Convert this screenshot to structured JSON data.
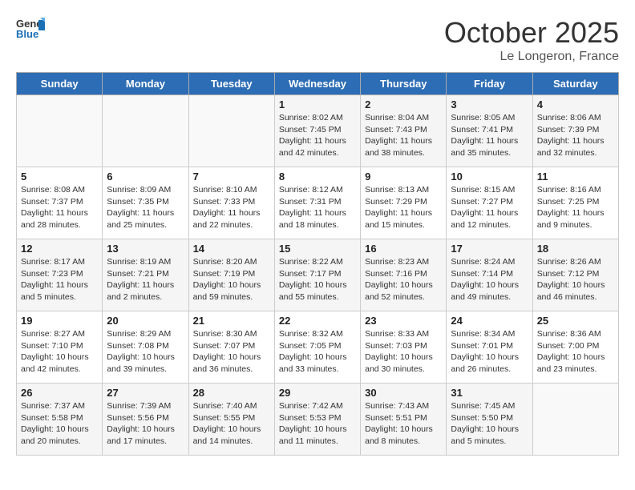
{
  "logo": {
    "line1": "General",
    "line2": "Blue"
  },
  "title": "October 2025",
  "location": "Le Longeron, France",
  "days_header": [
    "Sunday",
    "Monday",
    "Tuesday",
    "Wednesday",
    "Thursday",
    "Friday",
    "Saturday"
  ],
  "weeks": [
    [
      {
        "num": "",
        "info": ""
      },
      {
        "num": "",
        "info": ""
      },
      {
        "num": "",
        "info": ""
      },
      {
        "num": "1",
        "info": "Sunrise: 8:02 AM\nSunset: 7:45 PM\nDaylight: 11 hours and 42 minutes."
      },
      {
        "num": "2",
        "info": "Sunrise: 8:04 AM\nSunset: 7:43 PM\nDaylight: 11 hours and 38 minutes."
      },
      {
        "num": "3",
        "info": "Sunrise: 8:05 AM\nSunset: 7:41 PM\nDaylight: 11 hours and 35 minutes."
      },
      {
        "num": "4",
        "info": "Sunrise: 8:06 AM\nSunset: 7:39 PM\nDaylight: 11 hours and 32 minutes."
      }
    ],
    [
      {
        "num": "5",
        "info": "Sunrise: 8:08 AM\nSunset: 7:37 PM\nDaylight: 11 hours and 28 minutes."
      },
      {
        "num": "6",
        "info": "Sunrise: 8:09 AM\nSunset: 7:35 PM\nDaylight: 11 hours and 25 minutes."
      },
      {
        "num": "7",
        "info": "Sunrise: 8:10 AM\nSunset: 7:33 PM\nDaylight: 11 hours and 22 minutes."
      },
      {
        "num": "8",
        "info": "Sunrise: 8:12 AM\nSunset: 7:31 PM\nDaylight: 11 hours and 18 minutes."
      },
      {
        "num": "9",
        "info": "Sunrise: 8:13 AM\nSunset: 7:29 PM\nDaylight: 11 hours and 15 minutes."
      },
      {
        "num": "10",
        "info": "Sunrise: 8:15 AM\nSunset: 7:27 PM\nDaylight: 11 hours and 12 minutes."
      },
      {
        "num": "11",
        "info": "Sunrise: 8:16 AM\nSunset: 7:25 PM\nDaylight: 11 hours and 9 minutes."
      }
    ],
    [
      {
        "num": "12",
        "info": "Sunrise: 8:17 AM\nSunset: 7:23 PM\nDaylight: 11 hours and 5 minutes."
      },
      {
        "num": "13",
        "info": "Sunrise: 8:19 AM\nSunset: 7:21 PM\nDaylight: 11 hours and 2 minutes."
      },
      {
        "num": "14",
        "info": "Sunrise: 8:20 AM\nSunset: 7:19 PM\nDaylight: 10 hours and 59 minutes."
      },
      {
        "num": "15",
        "info": "Sunrise: 8:22 AM\nSunset: 7:17 PM\nDaylight: 10 hours and 55 minutes."
      },
      {
        "num": "16",
        "info": "Sunrise: 8:23 AM\nSunset: 7:16 PM\nDaylight: 10 hours and 52 minutes."
      },
      {
        "num": "17",
        "info": "Sunrise: 8:24 AM\nSunset: 7:14 PM\nDaylight: 10 hours and 49 minutes."
      },
      {
        "num": "18",
        "info": "Sunrise: 8:26 AM\nSunset: 7:12 PM\nDaylight: 10 hours and 46 minutes."
      }
    ],
    [
      {
        "num": "19",
        "info": "Sunrise: 8:27 AM\nSunset: 7:10 PM\nDaylight: 10 hours and 42 minutes."
      },
      {
        "num": "20",
        "info": "Sunrise: 8:29 AM\nSunset: 7:08 PM\nDaylight: 10 hours and 39 minutes."
      },
      {
        "num": "21",
        "info": "Sunrise: 8:30 AM\nSunset: 7:07 PM\nDaylight: 10 hours and 36 minutes."
      },
      {
        "num": "22",
        "info": "Sunrise: 8:32 AM\nSunset: 7:05 PM\nDaylight: 10 hours and 33 minutes."
      },
      {
        "num": "23",
        "info": "Sunrise: 8:33 AM\nSunset: 7:03 PM\nDaylight: 10 hours and 30 minutes."
      },
      {
        "num": "24",
        "info": "Sunrise: 8:34 AM\nSunset: 7:01 PM\nDaylight: 10 hours and 26 minutes."
      },
      {
        "num": "25",
        "info": "Sunrise: 8:36 AM\nSunset: 7:00 PM\nDaylight: 10 hours and 23 minutes."
      }
    ],
    [
      {
        "num": "26",
        "info": "Sunrise: 7:37 AM\nSunset: 5:58 PM\nDaylight: 10 hours and 20 minutes."
      },
      {
        "num": "27",
        "info": "Sunrise: 7:39 AM\nSunset: 5:56 PM\nDaylight: 10 hours and 17 minutes."
      },
      {
        "num": "28",
        "info": "Sunrise: 7:40 AM\nSunset: 5:55 PM\nDaylight: 10 hours and 14 minutes."
      },
      {
        "num": "29",
        "info": "Sunrise: 7:42 AM\nSunset: 5:53 PM\nDaylight: 10 hours and 11 minutes."
      },
      {
        "num": "30",
        "info": "Sunrise: 7:43 AM\nSunset: 5:51 PM\nDaylight: 10 hours and 8 minutes."
      },
      {
        "num": "31",
        "info": "Sunrise: 7:45 AM\nSunset: 5:50 PM\nDaylight: 10 hours and 5 minutes."
      },
      {
        "num": "",
        "info": ""
      }
    ]
  ]
}
